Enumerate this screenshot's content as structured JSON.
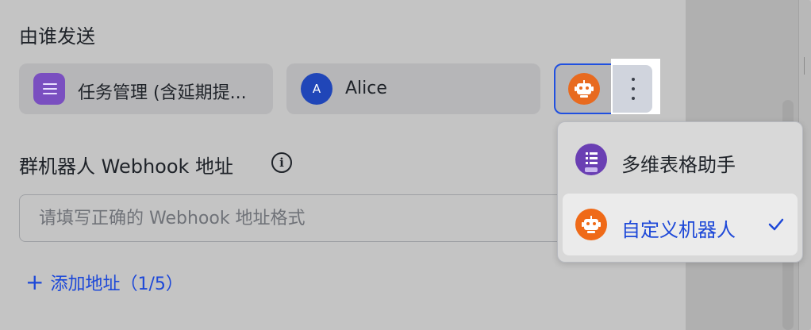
{
  "sender": {
    "title": "由谁发送",
    "options": [
      {
        "label": "任务管理 (含延期提...",
        "icon": "list-app-icon"
      },
      {
        "label": "Alice",
        "avatar_letter": "A",
        "icon": "user-avatar"
      }
    ],
    "selected_icon": "robot-icon",
    "more_icon": "more-vertical-icon"
  },
  "webhook": {
    "label": "群机器人 Webhook 地址",
    "info_icon": "info-icon",
    "info_glyph": "i",
    "placeholder": "请填写正确的 Webhook 地址格式",
    "value": ""
  },
  "add_address": {
    "plus": "+",
    "label": "添加地址（1/5）"
  },
  "dropdown": {
    "items": [
      {
        "label": "多维表格助手",
        "icon": "bitable-bot-icon",
        "selected": false
      },
      {
        "label": "自定义机器人",
        "icon": "robot-icon",
        "selected": true
      }
    ],
    "check_icon": "check-icon"
  },
  "colors": {
    "accent": "#1d48d8",
    "overlay": "#c4c4c4",
    "robot": "#e86a1f",
    "purple": "#6a3fb3"
  }
}
